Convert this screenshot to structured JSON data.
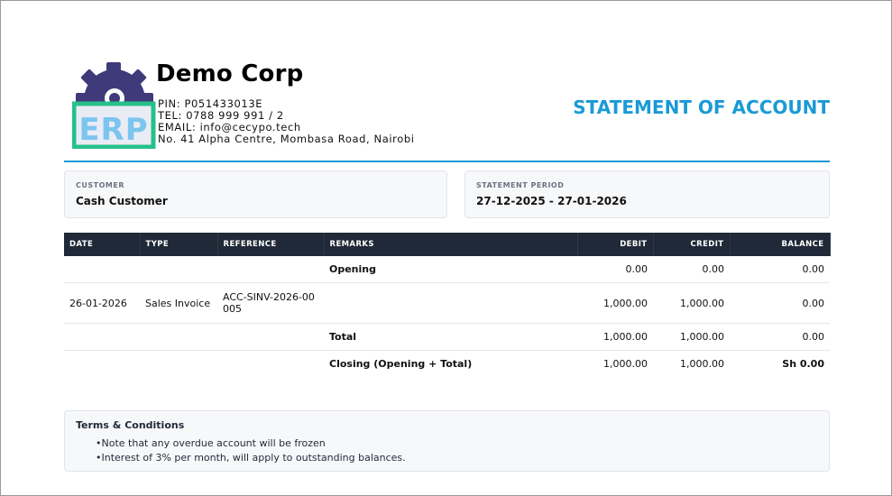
{
  "company": {
    "name": "Demo Corp",
    "logo_text": "ERP",
    "lines": [
      "PIN: P051433013E",
      "TEL: 0788 999 991 / 2",
      "EMAIL: info@cecypo.tech",
      "No. 41 Alpha Centre, Mombasa Road, Nairobi"
    ]
  },
  "document": {
    "title": "STATEMENT OF ACCOUNT",
    "accent_color": "#1a9ad6"
  },
  "customer": {
    "label": "CUSTOMER",
    "value": "Cash Customer"
  },
  "period": {
    "label": "STATEMENT PERIOD",
    "value": "27-12-2025 - 27-01-2026"
  },
  "table": {
    "headers": [
      "DATE",
      "TYPE",
      "REFERENCE",
      "REMARKS",
      "DEBIT",
      "CREDIT",
      "BALANCE"
    ],
    "rows": [
      {
        "date": "",
        "type": "",
        "reference": "",
        "remarks": "Opening",
        "debit": "0.00",
        "credit": "0.00",
        "balance": "0.00"
      },
      {
        "date": "26-01-2026",
        "type": "Sales Invoice",
        "reference": "ACC-SINV-2026-00005",
        "remarks": "",
        "debit": "1,000.00",
        "credit": "1,000.00",
        "balance": "0.00"
      },
      {
        "date": "",
        "type": "",
        "reference": "",
        "remarks": "Total",
        "debit": "1,000.00",
        "credit": "1,000.00",
        "balance": "0.00"
      },
      {
        "date": "",
        "type": "",
        "reference": "",
        "remarks": "Closing (Opening + Total)",
        "debit": "1,000.00",
        "credit": "1,000.00",
        "balance": "Sh 0.00"
      }
    ]
  },
  "terms": {
    "title": "Terms & Conditions",
    "items": [
      "Note that any overdue account will be frozen",
      "Interest of 3% per month, will apply to outstanding balances."
    ]
  }
}
